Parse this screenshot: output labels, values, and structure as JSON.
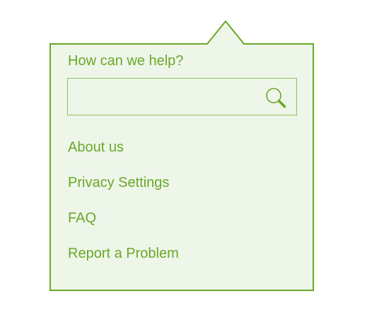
{
  "colors": {
    "accent": "#6aa827",
    "panel_background": "#eef6ea",
    "input_border": "#8fc15e"
  },
  "help_popover": {
    "heading": "How can we help?",
    "search": {
      "value": "",
      "placeholder": "",
      "icon": "search-icon"
    },
    "links": [
      {
        "label": "About us"
      },
      {
        "label": "Privacy Settings"
      },
      {
        "label": "FAQ"
      },
      {
        "label": "Report a Problem"
      }
    ]
  }
}
